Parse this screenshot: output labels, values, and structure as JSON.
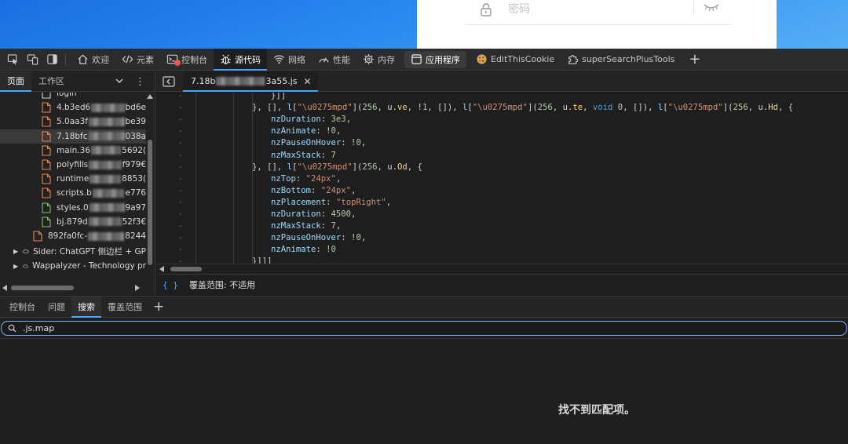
{
  "page": {
    "password_placeholder": "密码"
  },
  "toolbar": {
    "tabs": [
      {
        "label": "欢迎",
        "icon": "home-icon"
      },
      {
        "label": "元素",
        "icon": "code-tags-icon"
      },
      {
        "label": "控制台",
        "icon": "console-icon"
      },
      {
        "label": "源代码",
        "icon": "bug-icon"
      },
      {
        "label": "网络",
        "icon": "wifi-icon"
      },
      {
        "label": "性能",
        "icon": "gauge-icon"
      },
      {
        "label": "内存",
        "icon": "chip-icon"
      },
      {
        "label": "应用程序",
        "icon": "application-icon"
      },
      {
        "label": "EditThisCookie",
        "icon": "cookie-icon"
      },
      {
        "label": "superSearchPlusTools",
        "icon": "puzzle-icon"
      }
    ],
    "add_tab": "+",
    "active_tab": "源代码",
    "console_badge_color": "#e9555a"
  },
  "navigator": {
    "tabs": [
      "页面",
      "工作区"
    ],
    "active_tab": "页面",
    "menu_glyph": "⋮",
    "files": [
      {
        "prefix": "login",
        "suffix": "",
        "type": "document"
      },
      {
        "prefix": "4.b3ed6",
        "suffix": "bd6e",
        "type": "script"
      },
      {
        "prefix": "5.0aa3f",
        "suffix": "be39",
        "type": "script"
      },
      {
        "prefix": "7.18bfc",
        "suffix": "038a",
        "type": "script"
      },
      {
        "prefix": "main.36",
        "suffix": "5692(",
        "type": "script"
      },
      {
        "prefix": "polyfills",
        "suffix": "f979€",
        "type": "script"
      },
      {
        "prefix": "runtime",
        "suffix": "8853(",
        "type": "script"
      },
      {
        "prefix": "scripts.b",
        "suffix": "e776",
        "type": "script"
      },
      {
        "prefix": "styles.0",
        "suffix": "9a97",
        "type": "stylesheet"
      },
      {
        "prefix": "bj.879d",
        "suffix": "52f3€",
        "type": "stylesheet"
      },
      {
        "prefix": "892fa0fc-",
        "suffix": "8244",
        "type": "script"
      }
    ],
    "extensions": [
      {
        "label": "Sider: ChatGPT 侧边栏 + GP"
      },
      {
        "label": "Wappalyzer - Technology pr"
      }
    ]
  },
  "editor": {
    "file_tab": {
      "prefix": "7.18b",
      "suffix": "3a55.js",
      "close": "✕"
    },
    "code_lines": [
      "}]]",
      "}, [], l[\"\\u0275mpd\"](256, u.ve, !1, []), l[\"\\u0275mpd\"](256, u.te, void 0, []), l[\"\\u0275mpd\"](256, u.Hd, {",
      "nzDuration: 3e3,",
      "nzAnimate: !0,",
      "nzPauseOnHover: !0,",
      "nzMaxStack: 7",
      "}, [], l[\"\\u0275mpd\"](256, u.Od, {",
      "nzTop: \"24px\",",
      "nzBottom: \"24px\",",
      "nzPlacement: \"topRight\",",
      "nzDuration: 4500,",
      "nzMaxStack: 7,",
      "nzPauseOnHover: !0,",
      "nzAnimate: !0",
      "}]]]"
    ],
    "gutter_mark": "-",
    "pretty_print": "{ }",
    "coverage": "覆盖范围: 不适用"
  },
  "drawer": {
    "tabs": [
      "控制台",
      "问题",
      "搜索",
      "覆盖范围"
    ],
    "active_tab": "搜索",
    "add": "+",
    "search_value": ".js.map",
    "no_results": "找不到匹配项。"
  },
  "colors": {
    "accent": "#4aa3ff",
    "string": "#ce9178",
    "property": "#9cdcfe",
    "number": "#b5cea8",
    "keyword": "#569cd6"
  }
}
